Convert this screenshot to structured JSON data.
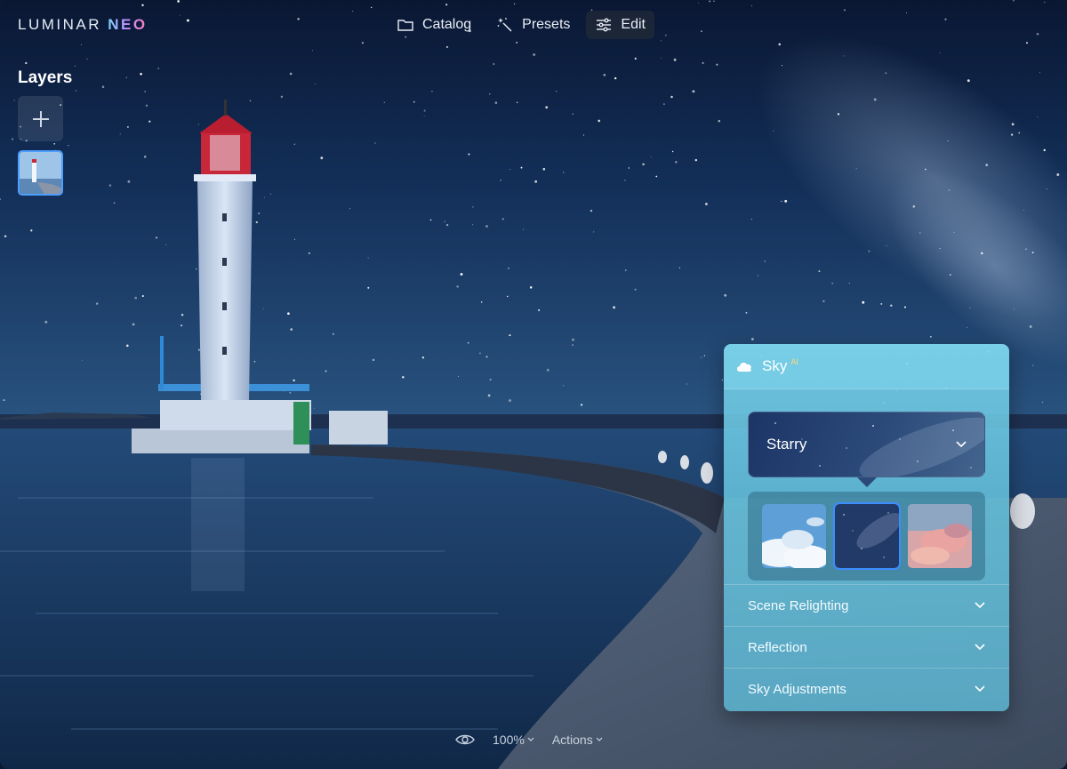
{
  "app": {
    "logo_main": "LUMINAR ",
    "logo_accent": "NEO"
  },
  "nav": {
    "items": [
      {
        "label": "Catalog",
        "icon": "folder-icon"
      },
      {
        "label": "Presets",
        "icon": "magic-wand-icon"
      },
      {
        "label": "Edit",
        "icon": "sliders-icon",
        "active": true
      }
    ]
  },
  "layers": {
    "title": "Layers",
    "add_icon": "plus-icon"
  },
  "sky_panel": {
    "title": "Sky",
    "badge": "AI",
    "selected_sky": "Starry",
    "thumbnails": [
      {
        "name": "clouds",
        "selected": false
      },
      {
        "name": "starry",
        "selected": true
      },
      {
        "name": "sunset",
        "selected": false
      }
    ],
    "sections": [
      {
        "label": "Scene Relighting"
      },
      {
        "label": "Reflection"
      },
      {
        "label": "Sky Adjustments"
      }
    ]
  },
  "bottom": {
    "zoom": "100%",
    "actions": "Actions"
  },
  "colors": {
    "accent": "#3c8dff",
    "panel": "#78d4ec",
    "sky_top": "#0b1a36",
    "water": "#1a3f6b"
  }
}
